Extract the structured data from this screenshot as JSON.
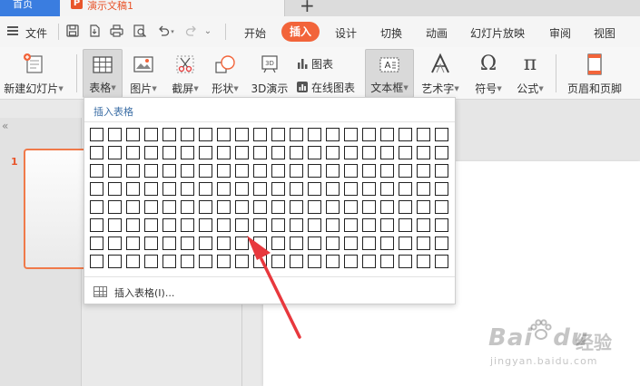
{
  "tabs": {
    "home": "首页",
    "document": "演示文稿1",
    "new_tab": "+"
  },
  "menubar": {
    "file": "文件",
    "items": [
      "开始",
      "插入",
      "设计",
      "切换",
      "动画",
      "幻灯片放映",
      "审阅",
      "视图"
    ],
    "active": "插入"
  },
  "ribbon": {
    "new_slide": "新建幻灯片",
    "table": "表格",
    "picture": "图片",
    "screenshot": "截屏",
    "shape": "形状",
    "3d": "3D演示",
    "chart": "图表",
    "online_chart": "在线图表",
    "textbox": "文本框",
    "wordart": "艺术字",
    "symbol": "符号",
    "formula": "公式",
    "header_footer": "页眉和页脚",
    "textbox_icon_text": "A"
  },
  "left_panel": {
    "collapse": "«",
    "slide_number": "1"
  },
  "dropdown": {
    "title": "插入表格",
    "grid_cols": 20,
    "grid_rows": 8,
    "insert_table": "插入表格(I)..."
  },
  "watermark": {
    "brand": "Bai",
    "brand2": "du",
    "label": "经验",
    "url": "jingyan.baidu.com"
  },
  "colors": {
    "accent": "#f2643a",
    "home_tab": "#3a7de0",
    "annotation_arrow": "#e8383d",
    "dropdown_title": "#3b6ea5"
  }
}
